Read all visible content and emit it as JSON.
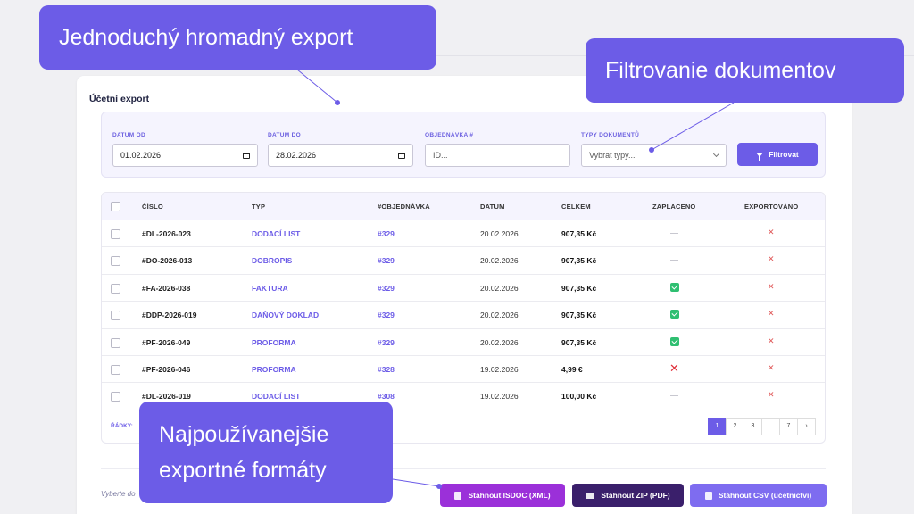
{
  "callouts": {
    "top": "Jednoduchý hromadný export",
    "filter": "Filtrovanie dokumentov",
    "formats_line1": "Najpoužívanejšie",
    "formats_line2": "exportné formáty"
  },
  "card": {
    "title": "Účetní export"
  },
  "filters": {
    "date_from": {
      "label": "DATUM OD",
      "value": "01.02.2026"
    },
    "date_to": {
      "label": "DATUM DO",
      "value": "28.02.2026"
    },
    "order": {
      "label": "OBJEDNÁVKA #",
      "placeholder": "ID..."
    },
    "doc_types": {
      "label": "TYPY DOKUMENTŮ",
      "value": "Vybrat typy..."
    },
    "filter_button": "Filtrovat"
  },
  "table": {
    "headers": [
      "ČÍSLO",
      "TYP",
      "#OBJEDNÁVKA",
      "DATUM",
      "CELKEM",
      "ZAPLACENO",
      "EXPORTOVÁNO"
    ],
    "rows": [
      {
        "number": "#DL-2026-023",
        "type": "DODACÍ LIST",
        "order": "#329",
        "date": "20.02.2026",
        "total": "907,35 Kč",
        "paid": "none",
        "exported": "no"
      },
      {
        "number": "#DO-2026-013",
        "type": "DOBROPIS",
        "order": "#329",
        "date": "20.02.2026",
        "total": "907,35 Kč",
        "paid": "none",
        "exported": "no"
      },
      {
        "number": "#FA-2026-038",
        "type": "FAKTURA",
        "order": "#329",
        "date": "20.02.2026",
        "total": "907,35 Kč",
        "paid": "yes",
        "exported": "no"
      },
      {
        "number": "#DDP-2026-019",
        "type": "DAŇOVÝ DOKLAD",
        "order": "#329",
        "date": "20.02.2026",
        "total": "907,35 Kč",
        "paid": "yes",
        "exported": "no"
      },
      {
        "number": "#PF-2026-049",
        "type": "PROFORMA",
        "order": "#329",
        "date": "20.02.2026",
        "total": "907,35 Kč",
        "paid": "yes",
        "exported": "no"
      },
      {
        "number": "#PF-2026-046",
        "type": "PROFORMA",
        "order": "#328",
        "date": "19.02.2026",
        "total": "4,99 €",
        "paid": "no",
        "exported": "no"
      },
      {
        "number": "#DL-2026-019",
        "type": "DODACÍ LIST",
        "order": "#308",
        "date": "19.02.2026",
        "total": "100,00 Kč",
        "paid": "none",
        "exported": "no"
      }
    ],
    "rows_label": "ŘÁDKY:",
    "pagination": [
      "1",
      "2",
      "3",
      "...",
      "7",
      "›"
    ]
  },
  "export": {
    "hint": "Vyberte do",
    "isdoc": "Stáhnout ISDOC (XML)",
    "zip": "Stáhnout ZIP (PDF)",
    "csv": "Stáhnout CSV (účetnictví)"
  },
  "colors": {
    "accent": "#6c5ce7",
    "isdoc": "#9b30d9",
    "zip": "#3a1f6b",
    "csv": "#7e6cf0"
  }
}
